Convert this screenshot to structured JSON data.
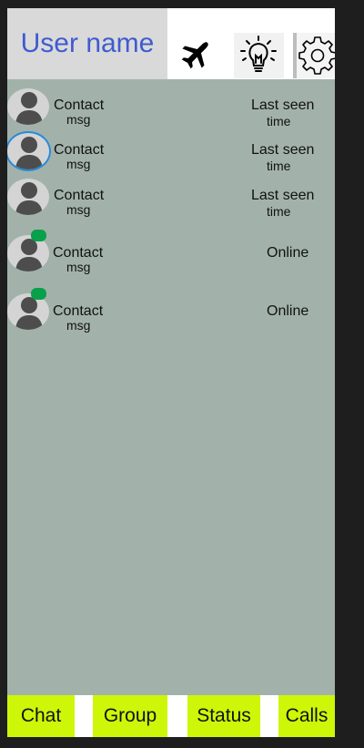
{
  "header": {
    "username": "User name",
    "icons": [
      "airplane-icon",
      "lightbulb-icon",
      "gear-icon"
    ]
  },
  "contacts": [
    {
      "name": "Contact",
      "msg": "msg",
      "status": "Last seen",
      "status_detail": "time",
      "online": false,
      "selected": false
    },
    {
      "name": "Contact",
      "msg": "msg",
      "status": "Last seen",
      "status_detail": "time",
      "online": false,
      "selected": true
    },
    {
      "name": "Contact",
      "msg": "msg",
      "status": "Last seen",
      "status_detail": "time",
      "online": false,
      "selected": false
    },
    {
      "name": "Contact",
      "msg": "msg",
      "status": "Online",
      "status_detail": "",
      "online": true,
      "selected": false
    },
    {
      "name": "Contact",
      "msg": "msg",
      "status": "Online",
      "status_detail": "",
      "online": true,
      "selected": false
    }
  ],
  "nav": {
    "chat": "Chat",
    "group": "Group",
    "status": "Status",
    "calls": "Calls"
  },
  "colors": {
    "username": "#3f5bd1",
    "list_background": "#a2b2ab",
    "nav_button": "#cdf609",
    "online_indicator": "#08a04a",
    "selected_ring": "#2a8ad8"
  }
}
